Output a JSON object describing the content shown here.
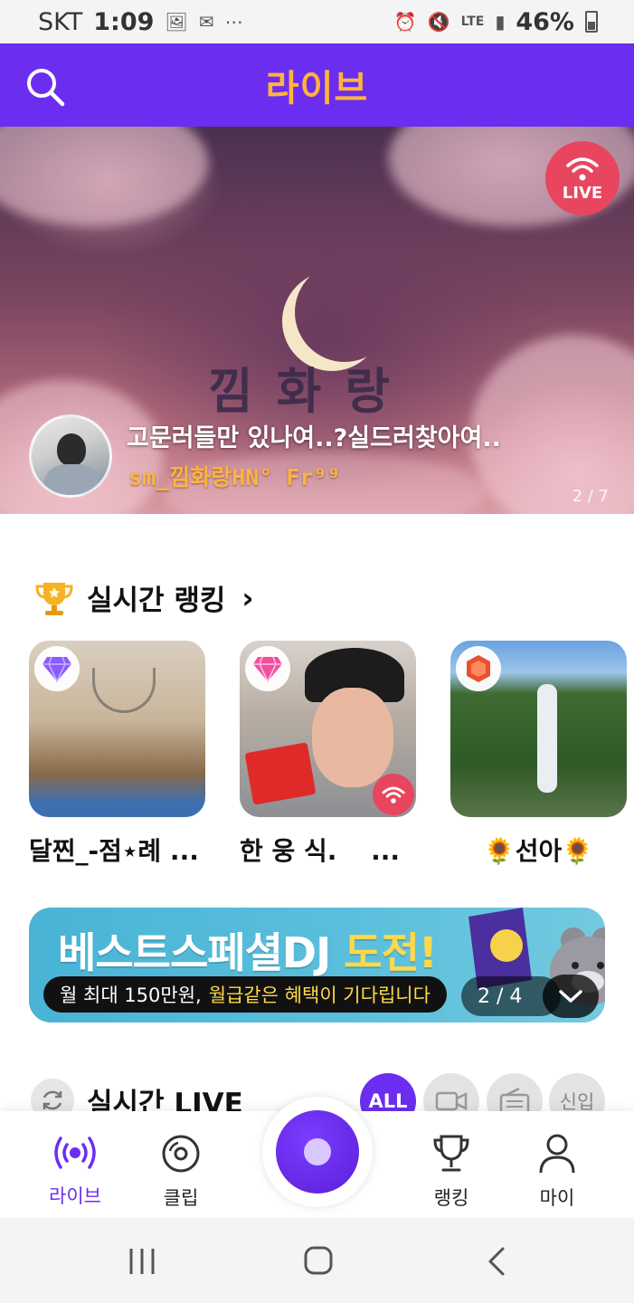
{
  "status_bar": {
    "carrier": "SKT",
    "time": "1:09",
    "network": "LTE",
    "battery": "46%"
  },
  "header": {
    "title": "라이브"
  },
  "banner": {
    "deco_text": "낌화랑",
    "title": "고문러들만 있나여..?실드러찾아여..",
    "host": "sm_낌화랑HN° Fr⁹⁹",
    "live_label": "LIVE",
    "pager": "2 / 7"
  },
  "ranking": {
    "title": "실시간 랭킹",
    "items": [
      {
        "name": "달찐_-점⋆례 ...",
        "gem": "purple-diamond",
        "color": "#8a5cff"
      },
      {
        "name": "한 웅 식.　 ...",
        "gem": "pink-diamond",
        "color": "#f04fa0"
      },
      {
        "name": "🌻선아🌻",
        "gem": "red-gem",
        "color": "#e8502f"
      }
    ]
  },
  "promo": {
    "main_prefix": "베스트스페셜DJ",
    "main_highlight": "도전!",
    "sub_prefix": "월 최대 150만원,",
    "sub_highlight": "월급같은 혜택이 기다립니다",
    "pager": "2 / 4"
  },
  "live_section": {
    "title": "실시간 LIVE",
    "filters": [
      {
        "label": "ALL",
        "active": true
      },
      {
        "label": "",
        "icon": "camera-icon"
      },
      {
        "label": "",
        "icon": "radio-icon"
      },
      {
        "label": "신입"
      }
    ]
  },
  "bottom_nav": {
    "items": [
      {
        "label": "라이브",
        "icon": "live-broadcast-icon",
        "active": true
      },
      {
        "label": "클립",
        "icon": "clip-disc-icon"
      },
      {
        "label": "랭킹",
        "icon": "trophy-icon"
      },
      {
        "label": "마이",
        "icon": "profile-icon"
      }
    ]
  },
  "colors": {
    "brand": "#6b2ef0",
    "accent": "#ffb43c",
    "live": "#e8455f"
  }
}
